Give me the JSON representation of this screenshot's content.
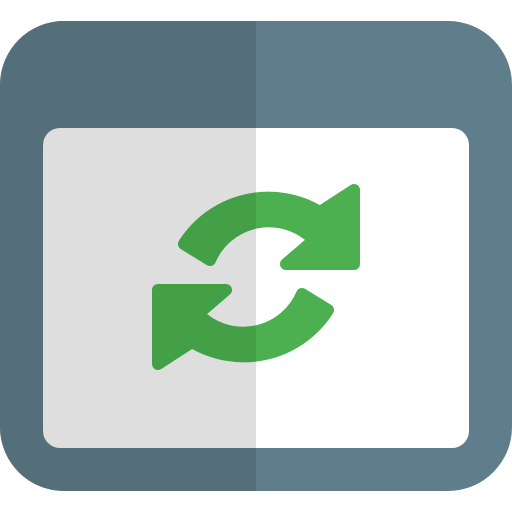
{
  "icon": {
    "name": "browser-refresh-icon",
    "colors": {
      "frame_light": "#607d8b",
      "frame_shade": "#546e7a",
      "content_light": "#ffffff",
      "content_shade": "#dedede",
      "arrows_light": "#4caf50",
      "arrows_shade": "#43a047"
    }
  }
}
